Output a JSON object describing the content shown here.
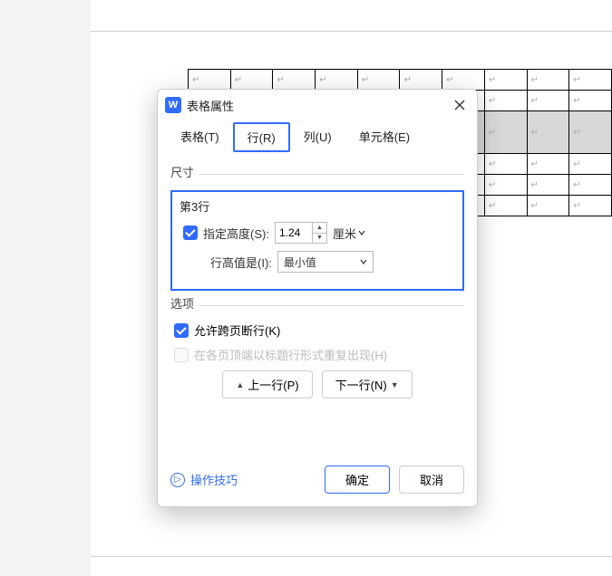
{
  "dialog": {
    "title": "表格属性",
    "tabs": [
      {
        "label": "表格(T)",
        "active": false
      },
      {
        "label": "行(R)",
        "active": true
      },
      {
        "label": "列(U)",
        "active": false
      },
      {
        "label": "单元格(E)",
        "active": false
      }
    ],
    "sections": {
      "size": {
        "heading": "尺寸",
        "row_title": "第3行",
        "spec_height": {
          "checked": true,
          "label": "指定高度(S):",
          "value": "1.24",
          "unit": "厘米"
        },
        "height_is": {
          "label": "行高值是(I):",
          "value": "最小值"
        }
      },
      "options": {
        "heading": "选项",
        "allow_break": {
          "checked": true,
          "label": "允许跨页断行(K)"
        },
        "repeat_header": {
          "checked": false,
          "enabled": false,
          "label": "在各页顶端以标题行形式重复出现(H)"
        }
      }
    },
    "nav": {
      "prev": "上一行(P)",
      "next": "下一行(N)"
    },
    "footer": {
      "tips": "操作技巧",
      "ok": "确定",
      "cancel": "取消"
    }
  },
  "cell_mark": "↵",
  "icons": {
    "app": "W",
    "tip": "▷"
  }
}
